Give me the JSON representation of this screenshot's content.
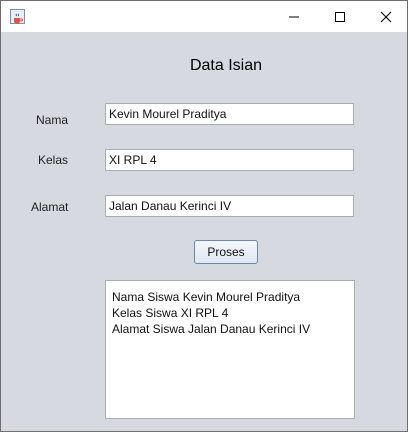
{
  "window": {
    "title": "",
    "icon": "java-cup-icon",
    "controls": {
      "minimize": "minimize-icon",
      "maximize": "maximize-icon",
      "close": "close-icon"
    }
  },
  "form": {
    "heading": "Data Isian",
    "nama": {
      "label": "Nama",
      "value": "Kevin Mourel Praditya"
    },
    "kelas": {
      "label": "Kelas",
      "value": "XI RPL 4"
    },
    "alamat": {
      "label": "Alamat",
      "value": "Jalan Danau Kerinci IV"
    },
    "button_label": "Proses"
  },
  "output": {
    "lines": [
      "Nama Siswa Kevin Mourel Praditya",
      "Kelas Siswa XI RPL 4",
      "Alamat Siswa Jalan Danau Kerinci IV"
    ]
  }
}
